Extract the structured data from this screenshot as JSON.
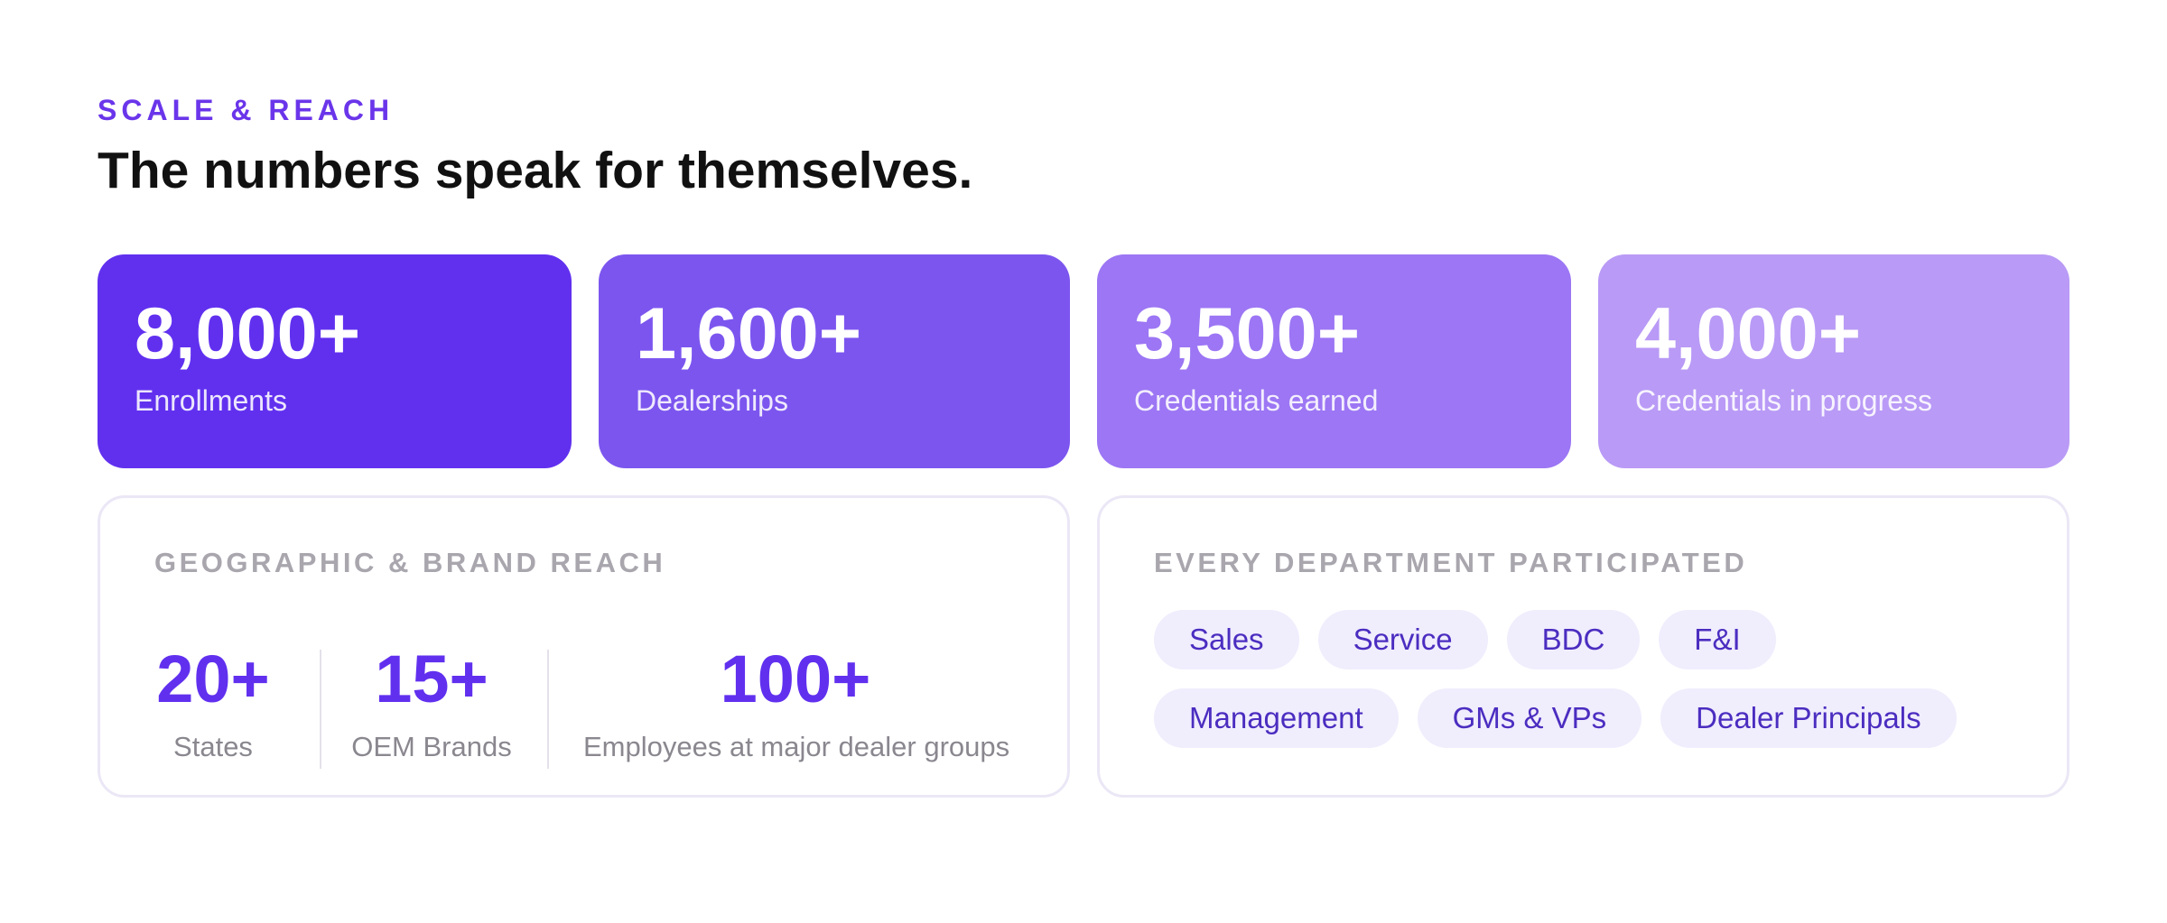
{
  "header": {
    "eyebrow": "SCALE & REACH",
    "headline": "The numbers speak for themselves."
  },
  "stats": [
    {
      "value": "8,000+",
      "label": "Enrollments"
    },
    {
      "value": "1,600+",
      "label": "Dealerships"
    },
    {
      "value": "3,500+",
      "label": "Credentials earned"
    },
    {
      "value": "4,000+",
      "label": "Credentials in progress"
    }
  ],
  "geo_panel": {
    "title": "GEOGRAPHIC & BRAND REACH",
    "items": [
      {
        "value": "20+",
        "label": "States"
      },
      {
        "value": "15+",
        "label": "OEM Brands"
      },
      {
        "value": "100+",
        "label": "Employees at major dealer groups"
      }
    ]
  },
  "dept_panel": {
    "title": "EVERY DEPARTMENT PARTICIPATED",
    "rows": [
      [
        "Sales",
        "Service",
        "BDC",
        "F&I"
      ],
      [
        "Management",
        "GMs & VPs",
        "Dealer Principals"
      ]
    ]
  },
  "colors": {
    "accent": "#6130ef",
    "card_1": "#6130ef",
    "card_2": "#7c55ef",
    "card_3": "#9c76f4",
    "card_4": "#b99af6",
    "chip_bg": "#f0edfd",
    "chip_text": "#4b2dc0"
  }
}
